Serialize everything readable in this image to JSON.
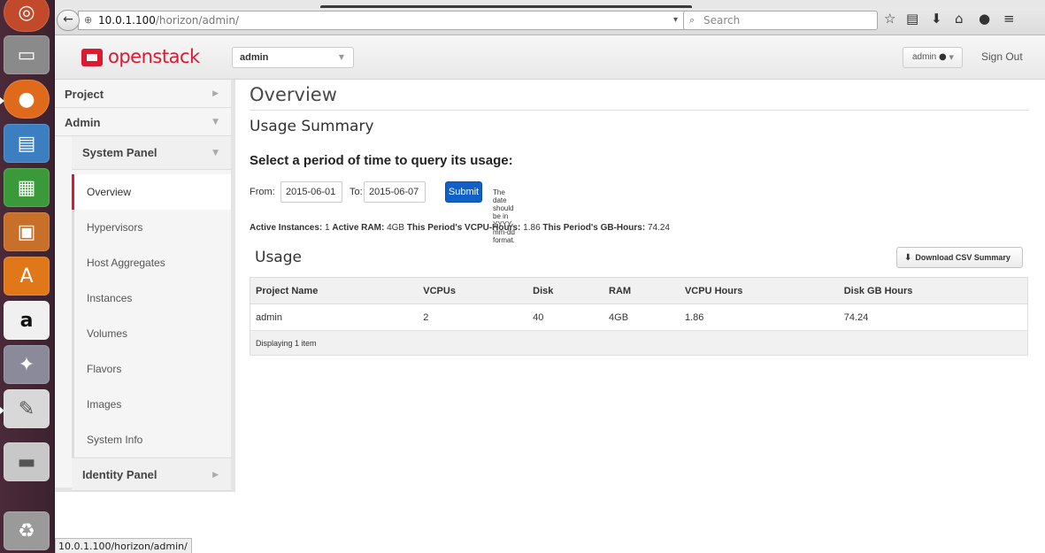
{
  "browser": {
    "url_host": "10.0.1.100",
    "url_path": "/horizon/admin/",
    "search_placeholder": "Search",
    "status_url": "10.0.1.100/horizon/admin/"
  },
  "header": {
    "logo_text": "openstack",
    "project_select": "admin",
    "user_label": "admin",
    "sign_out": "Sign Out"
  },
  "sidebar": {
    "project": "Project",
    "admin": "Admin",
    "system_panel": "System Panel",
    "items": [
      "Overview",
      "Hypervisors",
      "Host Aggregates",
      "Instances",
      "Volumes",
      "Flavors",
      "Images",
      "System Info"
    ],
    "identity_panel": "Identity Panel"
  },
  "main": {
    "title": "Overview",
    "usage_summary": "Usage Summary",
    "select_heading": "Select a period of time to query its usage:",
    "from_label": "From:",
    "from_value": "2015-06-01",
    "to_label": "To:",
    "to_value": "2015-06-07",
    "submit": "Submit",
    "date_hint": "The date should be in YYYY-mm-dd format.",
    "stats": {
      "active_instances_label": "Active Instances:",
      "active_instances": "1",
      "active_ram_label": "Active RAM:",
      "active_ram": "4GB",
      "vcpu_hours_label": "This Period's VCPU-Hours:",
      "vcpu_hours": "1.86",
      "gb_hours_label": "This Period's GB-Hours:",
      "gb_hours": "74.24"
    },
    "usage_heading": "Usage",
    "csv_button": "Download CSV Summary",
    "table": {
      "headers": [
        "Project Name",
        "VCPUs",
        "Disk",
        "RAM",
        "VCPU Hours",
        "Disk GB Hours"
      ],
      "rows": [
        [
          "admin",
          "2",
          "40",
          "4GB",
          "1.86",
          "74.24"
        ]
      ],
      "footer": "Displaying 1 item"
    }
  },
  "colors": {
    "brand": "#da1a32",
    "submit": "#1060c8",
    "launcher": "#4a2a38"
  }
}
